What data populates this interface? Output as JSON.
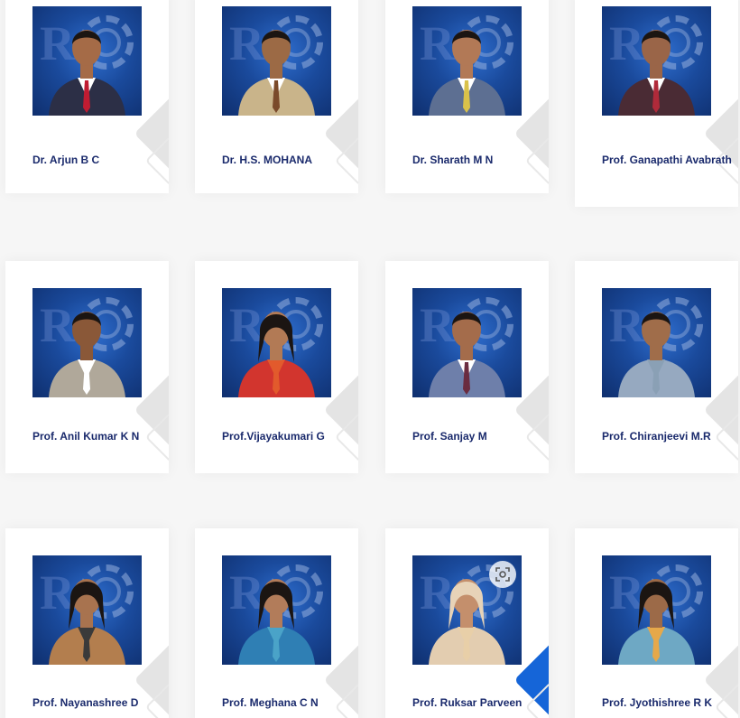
{
  "faculty": [
    {
      "name": "Dr. Arjun B C",
      "shirt": "#ffffff",
      "tie": "#c01c32",
      "suit": "#2c2f46",
      "skin": "#a56b47",
      "bg_label": "photo"
    },
    {
      "name": "Dr. H.S. MOHANA",
      "shirt": "#ffffff",
      "tie": "#7a4a2a",
      "suit": "#c9b48a",
      "skin": "#9c6a45"
    },
    {
      "name": "Dr. Sharath M N",
      "shirt": "#ffffff",
      "tie": "#d9c14a",
      "suit": "#5d6f92",
      "skin": "#b27956"
    },
    {
      "name": "Prof. Ganapathi Avabrath",
      "shirt": "#ffffff",
      "tie": "#b02a3a",
      "suit": "#4a2b34",
      "skin": "#9a6548"
    },
    {
      "name": "Prof. Anil Kumar K N",
      "shirt": "#ffffff",
      "tie": "#ffffff",
      "suit": "#b0a89a",
      "skin": "#8a5838"
    },
    {
      "name": "Prof.Vijayakumari G",
      "shirt": "#e25a2c",
      "tie": "#e25a2c",
      "suit": "#d2352e",
      "skin": "#b27a55"
    },
    {
      "name": "Prof. Sanjay M",
      "shirt": "#ffffff",
      "tie": "#6a2c40",
      "suit": "#6e7faa",
      "skin": "#a46c4b"
    },
    {
      "name": "Prof. Chiranjeevi M.R",
      "shirt": "#8aa0b5",
      "tie": "#8aa0b5",
      "suit": "#96a9c0",
      "skin": "#a06d4a"
    },
    {
      "name": "Prof. Nayanashree D",
      "shirt": "#3a3a3a",
      "tie": "#3a3a3a",
      "suit": "#b37e4e",
      "skin": "#a8734f"
    },
    {
      "name": "Prof. Meghana C N",
      "shirt": "#4aa3c8",
      "tie": "#4aa3c8",
      "suit": "#2f7fb4",
      "skin": "#b27c5a"
    },
    {
      "name": "Prof. Ruksar Parveen",
      "shirt": "#e8cfa8",
      "tie": "#e8cfa8",
      "suit": "#e3cdb0",
      "skin": "#c48f6c"
    },
    {
      "name": "Prof. Jyothishree R K",
      "shirt": "#e6a84a",
      "tie": "#e6a84a",
      "suit": "#6ea8c4",
      "skin": "#9c6a48"
    }
  ],
  "colors": {
    "name_text": "#1a2a6c",
    "accent": "#1565d8"
  },
  "icons": {
    "scan": "image-search-icon"
  }
}
